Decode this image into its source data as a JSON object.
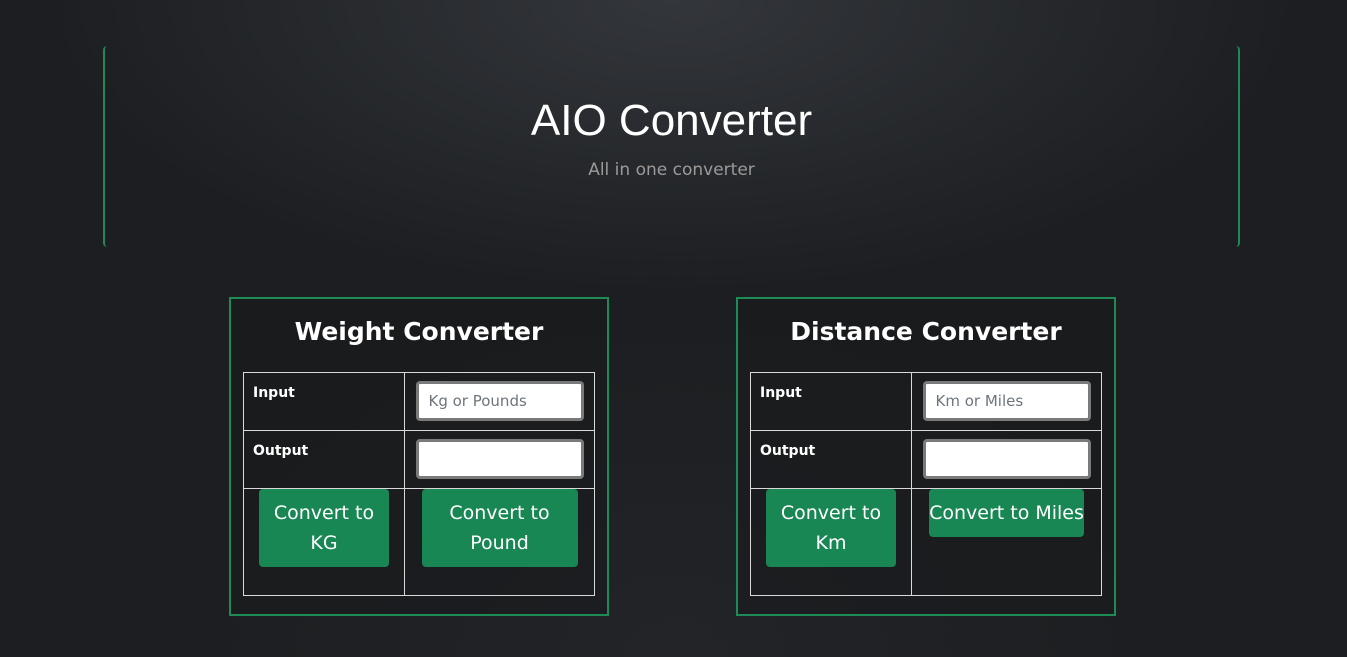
{
  "header": {
    "title": "AIO Converter",
    "subtitle": "All in one converter"
  },
  "weight": {
    "title": "Weight Converter",
    "input_label": "Input",
    "input_placeholder": "Kg or Pounds",
    "input_value": "",
    "output_label": "Output",
    "output_value": "",
    "btn_kg": "Convert to KG",
    "btn_pound": "Convert to Pound"
  },
  "distance": {
    "title": "Distance Converter",
    "input_label": "Input",
    "input_placeholder": "Km or Miles",
    "input_value": "",
    "output_label": "Output",
    "output_value": "",
    "btn_km": "Convert to Km",
    "btn_miles": "Convert to Miles"
  },
  "colors": {
    "accent": "#198754",
    "border": "#1e8a55",
    "background": "#1c1e21"
  }
}
